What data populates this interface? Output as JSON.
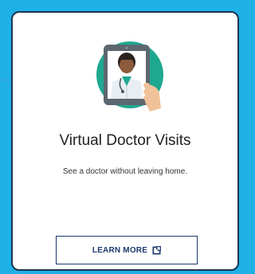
{
  "card": {
    "title": "Virtual Doctor Visits",
    "subtitle": "See a doctor without leaving home.",
    "button_label": "LEARN MORE",
    "button_icon": "external-link-icon",
    "illustration_icon": "doctor-tablet-icon",
    "pointer_icon": "curved-arrow-icon"
  },
  "colors": {
    "page_background": "#1fb0e6",
    "card_border": "#1c3550",
    "accent_teal": "#1ea890",
    "button_text": "#1c3a6e"
  }
}
